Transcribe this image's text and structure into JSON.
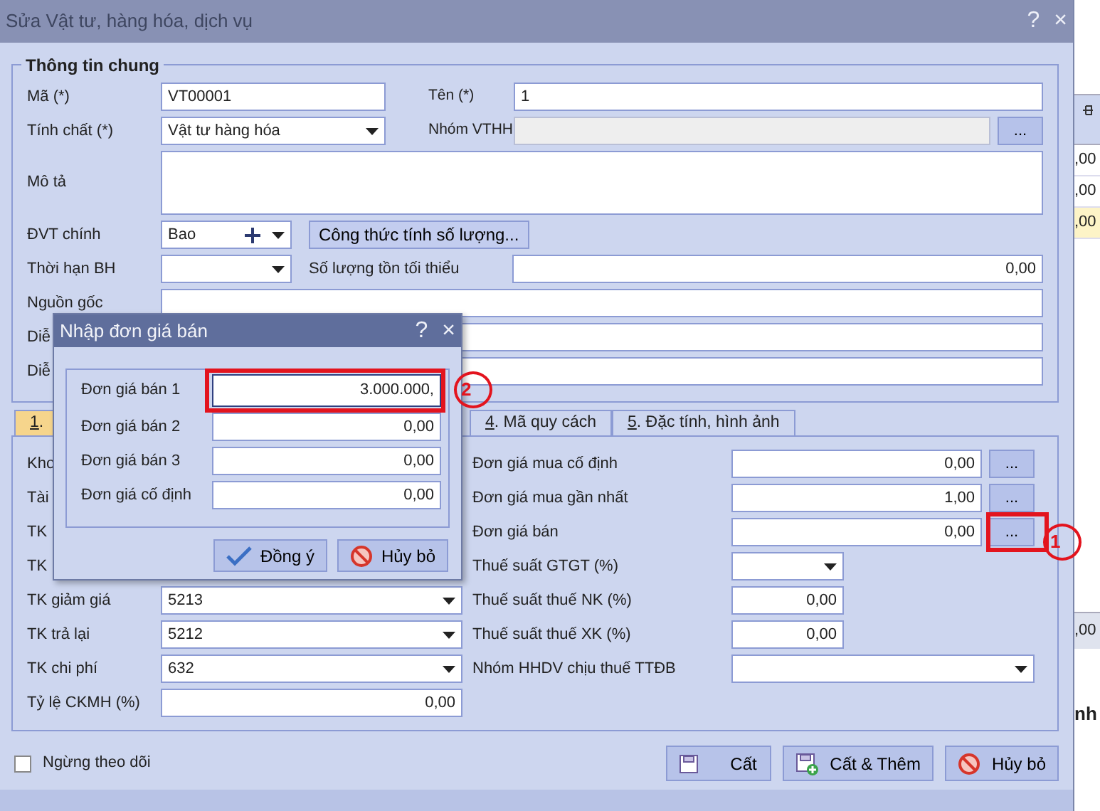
{
  "window": {
    "title": "Sửa Vật tư, hàng hóa, dịch vụ",
    "help": "?",
    "close": "×"
  },
  "general": {
    "legend": "Thông tin chung",
    "code": {
      "label": "Mã (*)",
      "value": "VT00001"
    },
    "name": {
      "label": "Tên (*)",
      "value": "1"
    },
    "nature": {
      "label": "Tính chất (*)",
      "value": "Vật tư hàng hóa"
    },
    "group": {
      "label": "Nhóm VTHH",
      "disabled": true,
      "button": "..."
    },
    "description": {
      "label": "Mô tả"
    },
    "unit": {
      "label": "ĐVT chính",
      "value": "Bao"
    },
    "formula_button": "Công thức tính số lượng...",
    "warranty": {
      "label": "Thời hạn BH"
    },
    "min_stock": {
      "label": "Số lượng tồn tối thiểu",
      "value": "0,00"
    },
    "more_rows": [
      {
        "label": "Nguồn gốc"
      },
      {
        "label": "Diễ"
      },
      {
        "label": "Diễ"
      }
    ]
  },
  "tabs": [
    {
      "accel": "1",
      "rest": ".",
      "selected": true
    },
    {
      "accel": "4",
      "rest": ". Mã quy cách",
      "selected": false
    },
    {
      "accel": "5",
      "rest": ". Đặc tính, hình ảnh",
      "selected": false
    }
  ],
  "left_rows": [
    {
      "kind": "covered",
      "label": "Kho"
    },
    {
      "kind": "covered",
      "label": "Tài"
    },
    {
      "kind": "covered",
      "label": "TK"
    },
    {
      "kind": "covered",
      "label": "TK"
    },
    {
      "kind": "select",
      "label": "TK giảm giá",
      "value": "5213"
    },
    {
      "kind": "select",
      "label": "TK trả lại",
      "value": "5212"
    },
    {
      "kind": "select",
      "label": "TK chi phí",
      "value": "632"
    },
    {
      "kind": "number",
      "label": "Tỷ lệ CKMH (%)",
      "value": "0,00"
    }
  ],
  "right_rows": [
    {
      "kind": "number-button",
      "label": "Đơn giá mua cố định",
      "value": "0,00",
      "button": "..."
    },
    {
      "kind": "number-button",
      "label": "Đơn giá mua gần nhất",
      "value": "1,00",
      "button": "..."
    },
    {
      "kind": "number-button",
      "label": "Đơn giá bán",
      "value": "0,00",
      "button": "...",
      "callout": "1"
    },
    {
      "kind": "select-short",
      "label": "Thuế suất GTGT (%)"
    },
    {
      "kind": "number-short",
      "label": "Thuế suất thuế NK (%)",
      "value": "0,00"
    },
    {
      "kind": "number-short",
      "label": "Thuế suất thuế XK (%)",
      "value": "0,00"
    },
    {
      "kind": "select-wide",
      "label": "Nhóm HHDV chịu thuế TTĐB"
    }
  ],
  "footer": {
    "inactive": {
      "label": "Ngừng theo dõi",
      "checked": false
    },
    "buttons": [
      {
        "kind": "save",
        "label": "Cất"
      },
      {
        "kind": "save-new",
        "label": "Cất & Thêm"
      },
      {
        "kind": "cancel",
        "label": "Hủy bỏ"
      }
    ]
  },
  "popup": {
    "title": "Nhập đơn giá bán",
    "help": "?",
    "close": "×",
    "rows": [
      {
        "label": "Đơn giá bán 1",
        "value": "3.000.000,",
        "focused": true,
        "callout": "2"
      },
      {
        "label": "Đơn giá bán 2",
        "value": "0,00",
        "focused": false
      },
      {
        "label": "Đơn giá bán 3",
        "value": "0,00",
        "focused": false
      },
      {
        "label": "Đơn giá cố định",
        "value": "0,00",
        "focused": false
      }
    ],
    "buttons": [
      {
        "kind": "ok",
        "label": "Đồng ý"
      },
      {
        "kind": "cancel",
        "label": "Hủy bỏ"
      }
    ]
  },
  "background_app": {
    "cells": [
      {
        "value": ",00",
        "selected": false
      },
      {
        "value": ",00",
        "selected": false
      },
      {
        "value": ",00",
        "selected": true
      }
    ],
    "total": ",00",
    "heading": "nh"
  }
}
